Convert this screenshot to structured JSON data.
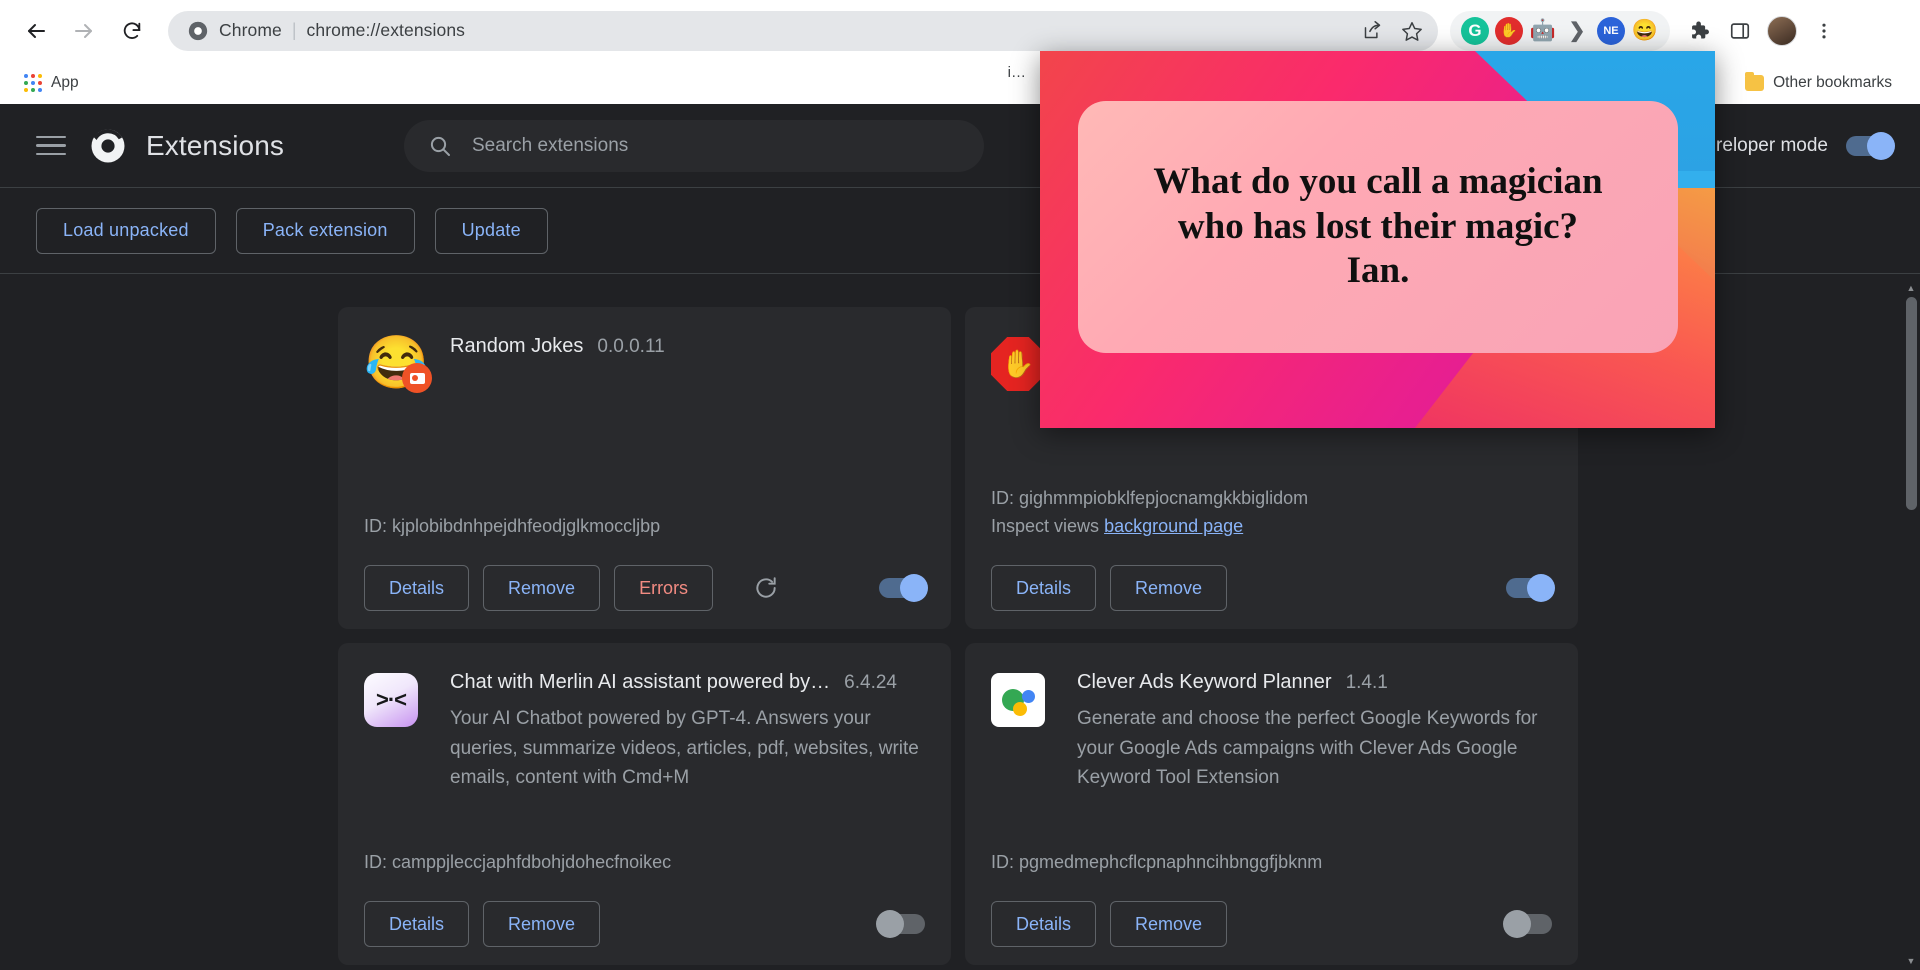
{
  "browser": {
    "nav": {
      "back_icon": "arrow-left-icon",
      "forward_icon": "arrow-right-icon",
      "reload_icon": "reload-icon"
    },
    "omnibox": {
      "site_icon": "chrome-icon",
      "site_label": "Chrome",
      "separator": "|",
      "url": "chrome://extensions",
      "share_icon": "share-icon",
      "bookmark_icon": "star-icon"
    },
    "extension_icons": [
      {
        "name": "grammarly-icon",
        "glyph": "G",
        "bg": "#15c39a",
        "fg": "#ffffff"
      },
      {
        "name": "adblock-icon",
        "glyph": "✋",
        "bg": "#e12d2d",
        "fg": "#ffffff"
      },
      {
        "name": "robot-assistant-icon",
        "glyph": "🤖",
        "bg": "transparent",
        "fg": "#e8820c"
      },
      {
        "name": "dark-reader-icon",
        "glyph": "⟩",
        "bg": "transparent",
        "fg": "#4a4d52"
      },
      {
        "name": "ne-extension-icon",
        "glyph": "NE",
        "bg": "#2b63d9",
        "fg": "#ffffff"
      },
      {
        "name": "random-jokes-icon",
        "glyph": "😄",
        "bg": "transparent",
        "fg": "#f6c244"
      }
    ],
    "toolbar_right": [
      {
        "name": "puzzle-extensions-icon"
      },
      {
        "name": "side-panel-icon"
      },
      {
        "name": "profile-avatar"
      },
      {
        "name": "chrome-menu-icon"
      }
    ],
    "bookmarks": {
      "apps_label": "Apps",
      "apps_icon": "apps-grid-icon",
      "other_bookmarks_label": "Other bookmarks",
      "other_bookmarks_icon": "folder-icon"
    }
  },
  "extensions_page": {
    "menu_icon": "hamburger-menu-icon",
    "logo_icon": "chrome-logo-icon",
    "title": "Extensions",
    "search": {
      "icon": "search-icon",
      "placeholder": "Search extensions",
      "value": ""
    },
    "developer_mode": {
      "label": "Developer mode",
      "visible_label": "reloper mode",
      "enabled": true
    },
    "dev_toolbar": [
      {
        "name": "load-unpacked-button",
        "label": "Load unpacked"
      },
      {
        "name": "pack-extension-button",
        "label": "Pack extension"
      },
      {
        "name": "update-button",
        "label": "Update"
      }
    ],
    "cards": [
      {
        "name": "Random Jokes",
        "version": "0.0.0.11",
        "description": "",
        "id_label": "ID: kjplobibdnhpejdhfeodjglkmoccljbp",
        "inspect_prefix": "",
        "inspect_link": "",
        "icon": "laughing-emoji-icon",
        "icon_glyph": "😂",
        "badge": "error-badge-icon",
        "buttons": [
          {
            "name": "details-button",
            "label": "Details",
            "style": "link"
          },
          {
            "name": "remove-button",
            "label": "Remove",
            "style": "link"
          },
          {
            "name": "errors-button",
            "label": "Errors",
            "style": "danger"
          }
        ],
        "has_reload": true,
        "enabled": true
      },
      {
        "name": "",
        "version": "",
        "description": "",
        "id_label": "ID: gighmmpiobklfepjocnamgkkbiglidom",
        "inspect_prefix": "Inspect views",
        "inspect_link": "background page",
        "icon": "stop-hand-icon",
        "icon_glyph": "✋",
        "badge": "",
        "buttons": [
          {
            "name": "details-button",
            "label": "Details",
            "style": "link"
          },
          {
            "name": "remove-button",
            "label": "Remove",
            "style": "link"
          }
        ],
        "has_reload": false,
        "enabled": true
      },
      {
        "name": "Chat with Merlin AI assistant powered by…",
        "version": "6.4.24",
        "description": "Your AI Chatbot powered by GPT-4. Answers your queries, summarize videos, articles, pdf, websites, write emails, content with Cmd+M",
        "id_label": "ID: camppjleccjaphfdbohjdohecfnoikec",
        "inspect_prefix": "",
        "inspect_link": "",
        "icon": "merlin-face-icon",
        "icon_glyph": ">·<",
        "badge": "",
        "buttons": [
          {
            "name": "details-button",
            "label": "Details",
            "style": "link"
          },
          {
            "name": "remove-button",
            "label": "Remove",
            "style": "link"
          }
        ],
        "has_reload": false,
        "enabled": false
      },
      {
        "name": "Clever Ads Keyword Planner",
        "version": "1.4.1",
        "description": "Generate and choose the perfect Google Keywords for your Google Ads campaigns with Clever Ads Google Keyword Tool Extension",
        "id_label": "ID: pgmedmephcflcpnaphncihbnggfjbknm",
        "inspect_prefix": "",
        "inspect_link": "",
        "icon": "clever-ads-bubbles-icon",
        "icon_glyph": "",
        "badge": "",
        "buttons": [
          {
            "name": "details-button",
            "label": "Details",
            "style": "link"
          },
          {
            "name": "remove-button",
            "label": "Remove",
            "style": "link"
          }
        ],
        "has_reload": false,
        "enabled": false
      }
    ],
    "scrollbar": {
      "up_arrow": "▲",
      "down_arrow": "▼"
    }
  },
  "popup": {
    "name": "random-jokes-popup",
    "joke_text": "What do you call a magician\nwho has lost their magic?\nIan.",
    "truncated_omnibox_hint": "i…"
  },
  "colors": {
    "page_bg": "#202124",
    "card_bg": "#292a2d",
    "link_blue": "#8ab4f8",
    "danger_red": "#f28b82",
    "muted_text": "#9aa0a6"
  }
}
